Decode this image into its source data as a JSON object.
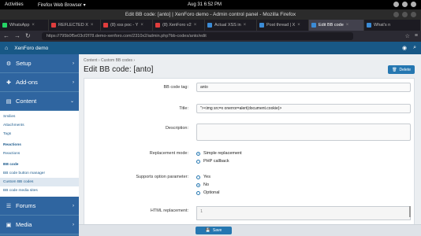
{
  "topbar": {
    "activities": "Activities",
    "app": "Firefox Web Browser ▾",
    "clock": "Aug 31  6:52 PM"
  },
  "window": {
    "title": "Edit BB code: [anto] | XenForo demo - Admin control panel - Mozilla Firefox"
  },
  "tabs": [
    {
      "label": "WhatsApp",
      "color": "#25d366"
    },
    {
      "label": "REFLECTED X",
      "color": "#e03d3d"
    },
    {
      "label": "(8) xss poc - Y",
      "color": "#e03d3d"
    },
    {
      "label": "(8) XenForo v2",
      "color": "#e03d3d"
    },
    {
      "label": "Actual XSS in",
      "color": "#3b8bd6"
    },
    {
      "label": "Post thread | X",
      "color": "#3b8bd6"
    },
    {
      "label": "Edit BB code",
      "color": "#3b8bd6"
    },
    {
      "label": "What's n",
      "color": "#3b8bd6"
    }
  ],
  "tab_close": "×",
  "url": "https://795b0f5e03cf2f78.demo-xenforo.com/2310x2/admin.php?bb-codes/anto/edit",
  "xf": {
    "site_name": "XenForo demo"
  },
  "sidebar": {
    "setup": "Setup",
    "addons": "Add-ons",
    "content": "Content",
    "forums": "Forums",
    "media": "Media",
    "items": [
      {
        "label": "Smilies",
        "group": false
      },
      {
        "label": "Attachments",
        "group": false
      },
      {
        "label": "Tags",
        "group": false
      },
      {
        "label": "Reactions",
        "group": true
      },
      {
        "label": "Reactions",
        "group": false
      },
      {
        "label": "BB code",
        "group": true
      },
      {
        "label": "BB code button manager",
        "group": false
      },
      {
        "label": "Custom BB codes",
        "group": false
      },
      {
        "label": "BB code media sites",
        "group": false
      }
    ]
  },
  "main": {
    "breadcrumb": "Content › Custom BB codes ›",
    "title": "Edit BB code: [anto]",
    "delete": "Delete",
    "save": "Save"
  },
  "form": {
    "tag_label": "BB code tag:",
    "tag_value": "anto",
    "title_label": "Title:",
    "title_value": "\"><img src=x onerror=alert(document.cookie)>",
    "description_label": "Description:",
    "replacement_mode_label": "Replacement mode:",
    "mode_options": [
      "Simple replacement",
      "PHP callback"
    ],
    "support_label": "Supports option parameter:",
    "support_options": [
      "Yes",
      "No",
      "Optional"
    ],
    "html_label": "HTML replacement:",
    "html_line": "1"
  },
  "colors": {
    "accent": "#2577b1",
    "sidebar": "#3b71a3",
    "header": "#185886"
  }
}
